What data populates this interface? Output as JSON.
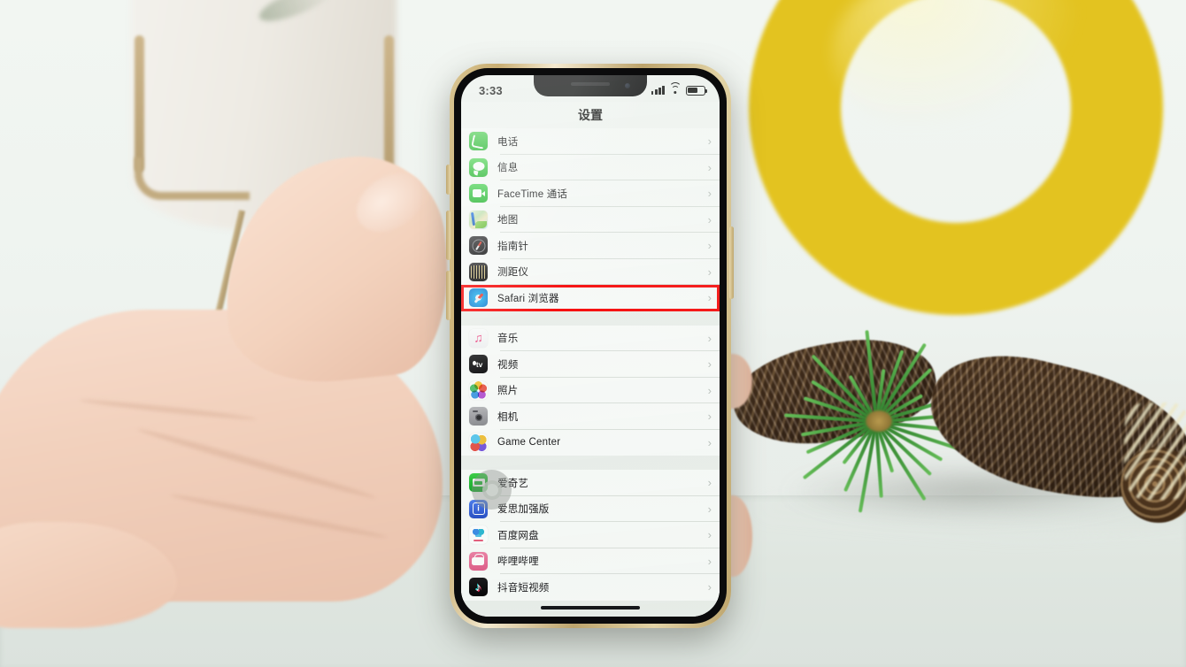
{
  "scene": {
    "description": "Hand holding a gold iPhone showing the iOS Settings app, on a white table with a yellow ring ornament, pine cones and pine branch"
  },
  "phone": {
    "statusbar": {
      "time": "3:33",
      "signal_icon": "cellular-signal-icon",
      "wifi_icon": "wifi-icon",
      "battery_icon": "battery-icon",
      "battery_level_percent": 62
    },
    "nav": {
      "title": "设置"
    },
    "groups": [
      {
        "id": "apple-apps-group",
        "rows": [
          {
            "label": "电话",
            "icon": "phone-app-icon",
            "icon_class": "ic-phone",
            "chevron": "›",
            "highlighted": false
          },
          {
            "label": "信息",
            "icon": "messages-app-icon",
            "icon_class": "ic-messages",
            "chevron": "›",
            "highlighted": false
          },
          {
            "label": "FaceTime 通话",
            "icon": "facetime-app-icon",
            "icon_class": "ic-facetime",
            "chevron": "›",
            "highlighted": false
          },
          {
            "label": "地图",
            "icon": "maps-app-icon",
            "icon_class": "ic-maps",
            "chevron": "›",
            "highlighted": false
          },
          {
            "label": "指南针",
            "icon": "compass-app-icon",
            "icon_class": "ic-compass",
            "chevron": "›",
            "highlighted": false
          },
          {
            "label": "测距仪",
            "icon": "measure-app-icon",
            "icon_class": "ic-measure",
            "chevron": "›",
            "highlighted": false
          },
          {
            "label": "Safari 浏览器",
            "icon": "safari-app-icon",
            "icon_class": "ic-safari",
            "chevron": "›",
            "highlighted": true
          }
        ]
      },
      {
        "id": "media-apps-group",
        "rows": [
          {
            "label": "音乐",
            "icon": "music-app-icon",
            "icon_class": "ic-music",
            "chevron": "›",
            "highlighted": false
          },
          {
            "label": "视频",
            "icon": "appletv-app-icon",
            "icon_class": "ic-tv",
            "chevron": "›",
            "highlighted": false
          },
          {
            "label": "照片",
            "icon": "photos-app-icon",
            "icon_class": "ic-photos",
            "chevron": "›",
            "highlighted": false
          },
          {
            "label": "相机",
            "icon": "camera-app-icon",
            "icon_class": "ic-camera",
            "chevron": "›",
            "highlighted": false
          },
          {
            "label": "Game Center",
            "icon": "game-center-app-icon",
            "icon_class": "ic-gamecenter",
            "chevron": "›",
            "highlighted": false
          }
        ]
      },
      {
        "id": "third-party-apps-group",
        "rows": [
          {
            "label": "爱奇艺",
            "icon": "iqiyi-app-icon",
            "icon_class": "ic-iqiyi",
            "chevron": "›",
            "highlighted": false
          },
          {
            "label": "爱思加强版",
            "icon": "i4tools-app-icon",
            "icon_class": "ic-i4",
            "chevron": "›",
            "highlighted": false
          },
          {
            "label": "百度网盘",
            "icon": "baidu-netdisk-app-icon",
            "icon_class": "ic-baidu",
            "chevron": "›",
            "highlighted": false
          },
          {
            "label": "哔哩哔哩",
            "icon": "bilibili-app-icon",
            "icon_class": "ic-bilibili",
            "chevron": "›",
            "highlighted": false
          },
          {
            "label": "抖音短视频",
            "icon": "douyin-app-icon",
            "icon_class": "ic-douyin",
            "chevron": "›",
            "highlighted": false
          }
        ]
      }
    ],
    "overlays": {
      "assistive_touch": "assistive-touch-button",
      "home_indicator": "home-indicator"
    }
  },
  "annotation": {
    "highlight_target": "Safari 浏览器",
    "highlight_color": "#fb1111"
  },
  "colors": {
    "highlight_red": "#fb1111",
    "phone_frame_gold": "#cdb47c",
    "screen_bg": "#f4f6f4",
    "list_bg": "#fbfcfb",
    "separator": "#dfe3df",
    "ring_yellow": "#e3c320",
    "pine_green": "#4aa043",
    "cone_brown": "#4a3320"
  }
}
